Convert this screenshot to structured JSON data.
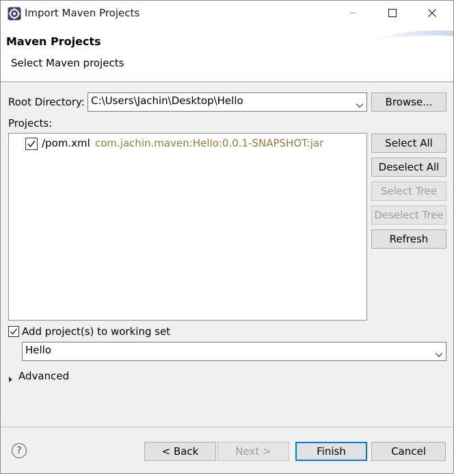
{
  "window": {
    "title": "Import Maven Projects",
    "controls": {
      "minimize": "minimize-icon",
      "maximize": "maximize-icon",
      "close": "close-icon"
    }
  },
  "banner": {
    "title": "Maven Projects",
    "description": "Select Maven projects"
  },
  "root_directory": {
    "label": "Root Directory:",
    "value": "C:\\Users\\Jachin\\Desktop\\Hello",
    "browse_label": "Browse..."
  },
  "projects": {
    "label": "Projects:",
    "items": [
      {
        "name": "/pom.xml",
        "coordinates": "com.jachin.maven:Hello:0.0.1-SNAPSHOT:jar",
        "checked": true
      }
    ]
  },
  "side_buttons": {
    "select_all": "Select All",
    "deselect_all": "Deselect All",
    "select_tree": "Select Tree",
    "deselect_tree": "Deselect Tree",
    "refresh": "Refresh"
  },
  "working_set": {
    "checkbox_label": "Add project(s) to working set",
    "checked": true,
    "value": "Hello"
  },
  "advanced": {
    "label": "Advanced"
  },
  "footer": {
    "back": "< Back",
    "next": "Next >",
    "finish": "Finish",
    "cancel": "Cancel"
  },
  "colors": {
    "coordinates_text": "#947c3d",
    "default_button_border": "#0078d7",
    "disabled_text": "#9c9c9c"
  }
}
